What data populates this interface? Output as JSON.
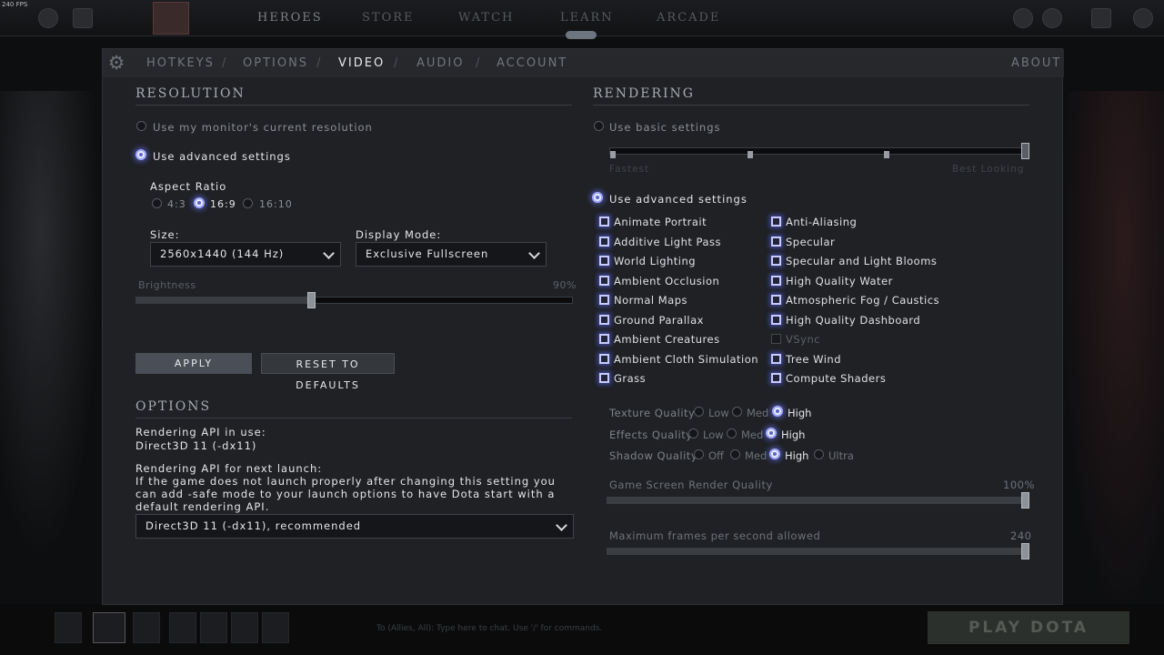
{
  "hud": {
    "fps": "240 FPS",
    "nav": [
      "HEROES",
      "STORE",
      "WATCH",
      "LEARN",
      "ARCADE"
    ],
    "play_button": "PLAY DOTA",
    "chat_placeholder": "To (Allies, All): Type here to chat. Use '/' for commands."
  },
  "tabs": {
    "items": [
      "HOTKEYS",
      "OPTIONS",
      "VIDEO",
      "AUDIO",
      "ACCOUNT"
    ],
    "active": "VIDEO",
    "about": "ABOUT"
  },
  "resolution": {
    "title": "RESOLUTION",
    "use_monitor": "Use my monitor's current resolution",
    "use_advanced": "Use advanced settings",
    "aspect_label": "Aspect Ratio",
    "aspect_options": [
      "4:3",
      "16:9",
      "16:10"
    ],
    "aspect_selected": "16:9",
    "size_label": "Size:",
    "size_value": "2560x1440 (144 Hz)",
    "display_mode_label": "Display Mode:",
    "display_mode_value": "Exclusive Fullscreen",
    "brightness_label": "Brightness",
    "brightness_value": "90%",
    "brightness_level": 0.4,
    "apply": "APPLY",
    "reset": "RESET TO DEFAULTS"
  },
  "options": {
    "title": "OPTIONS",
    "api_in_use_label": "Rendering API in use:",
    "api_in_use_value": "Direct3D 11 (-dx11)",
    "api_next_label": "Rendering API for next launch:",
    "api_note": "If the game does not launch properly after changing this setting you can add -safe mode to your launch options to have Dota start with a default rendering API.",
    "api_next_value": "Direct3D 11 (-dx11), recommended"
  },
  "rendering": {
    "title": "RENDERING",
    "use_basic": "Use basic settings",
    "basic_min_label": "Fastest",
    "basic_max_label": "Best Looking",
    "use_advanced": "Use advanced settings",
    "left_checks": [
      {
        "label": "Animate Portrait",
        "checked": true
      },
      {
        "label": "Additive Light Pass",
        "checked": true
      },
      {
        "label": "World Lighting",
        "checked": true
      },
      {
        "label": "Ambient Occlusion",
        "checked": true
      },
      {
        "label": "Normal Maps",
        "checked": true
      },
      {
        "label": "Ground Parallax",
        "checked": true
      },
      {
        "label": "Ambient Creatures",
        "checked": true
      },
      {
        "label": "Ambient Cloth Simulation",
        "checked": true
      },
      {
        "label": "Grass",
        "checked": true
      }
    ],
    "right_checks": [
      {
        "label": "Anti-Aliasing",
        "checked": true
      },
      {
        "label": "Specular",
        "checked": true
      },
      {
        "label": "Specular and Light Blooms",
        "checked": true
      },
      {
        "label": "High Quality Water",
        "checked": true
      },
      {
        "label": "Atmospheric Fog / Caustics",
        "checked": true
      },
      {
        "label": "High Quality Dashboard",
        "checked": true
      },
      {
        "label": "VSync",
        "checked": false
      },
      {
        "label": "Tree Wind",
        "checked": true
      },
      {
        "label": "Compute Shaders",
        "checked": true
      }
    ],
    "texture_quality": {
      "label": "Texture Quality",
      "options": [
        "Low",
        "Med",
        "High"
      ],
      "selected": "High"
    },
    "effects_quality": {
      "label": "Effects Quality",
      "options": [
        "Low",
        "Med",
        "High"
      ],
      "selected": "High"
    },
    "shadow_quality": {
      "label": "Shadow Quality",
      "options": [
        "Off",
        "Med",
        "High",
        "Ultra"
      ],
      "selected": "High"
    },
    "render_quality_label": "Game Screen Render Quality",
    "render_quality_value": "100%",
    "max_fps_label": "Maximum frames per second allowed",
    "max_fps_value": "240"
  }
}
